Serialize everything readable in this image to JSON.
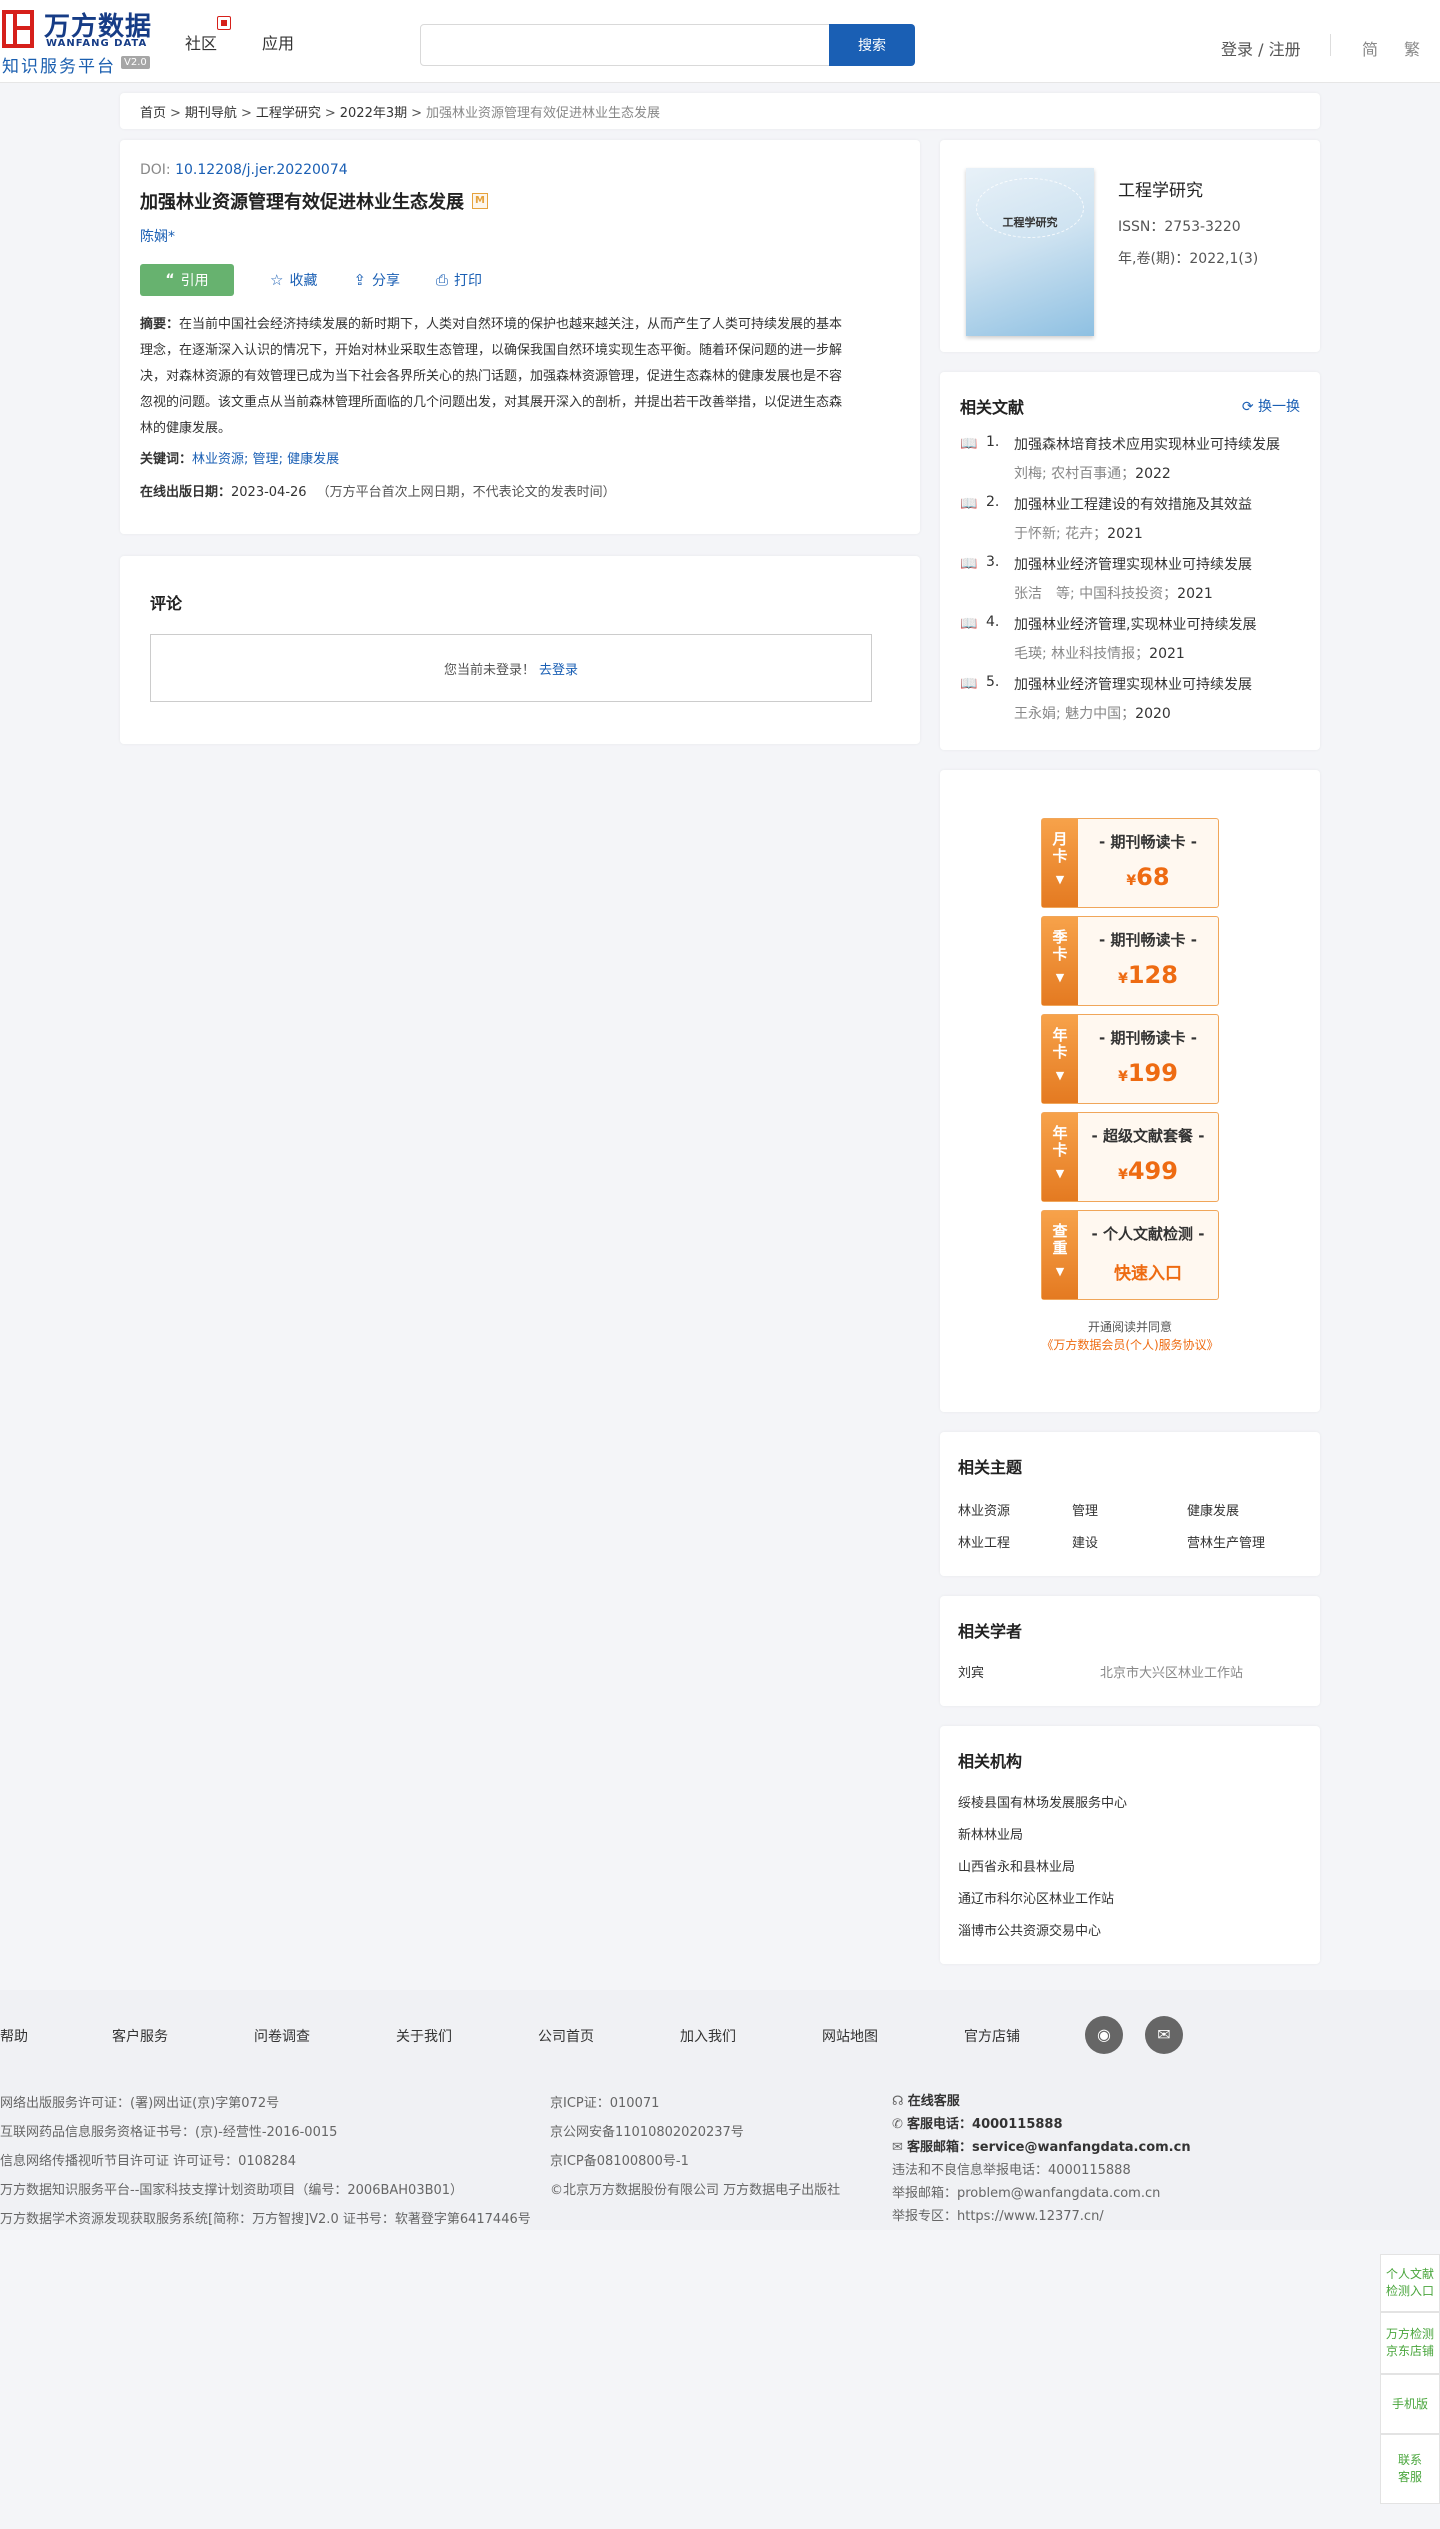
{
  "header": {
    "logo_cn": "万方数据",
    "logo_en": "WANFANG DATA",
    "logo_sub": "知识服务平台",
    "logo_ver": "V2.0",
    "nav": [
      "社区",
      "应用"
    ],
    "search_placeholder": "",
    "search_button": "搜索",
    "login": "登录 / 注册",
    "lang_simple": "简",
    "lang_trad": "繁"
  },
  "breadcrumb": {
    "items": [
      "首页",
      "期刊导航",
      "工程学研究",
      "2022年3期"
    ],
    "current": "加强林业资源管理有效促进林业生态发展",
    "sep": ">"
  },
  "article": {
    "doi_label": "DOI:",
    "doi": "10.12208/j.jer.20220074",
    "title": "加强林业资源管理有效促进林业生态发展",
    "badge": "M",
    "author": "陈娴*",
    "actions": {
      "cite": "引用",
      "favorite": "收藏",
      "share": "分享",
      "print": "打印"
    },
    "abstract_label": "摘要：",
    "abstract_lines": [
      "在当前中国社会经济持续发展的新时期下，人类对自然环境的保护也越来越关注，从而产生了人类可持续发展的基本",
      "理念，在逐渐深入认识的情况下，开始对林业采取生态管理，以确保我国自然环境实现生态平衡。随着环保问题的进一步解",
      "决，对森林资源的有效管理已成为当下社会各界所关心的热门话题，加强森林资源管理，促进生态森林的健康发展也是不容",
      "忽视的问题。该文重点从当前森林管理所面临的几个问题出发，对其展开深入的剖析，并提出若干改善举措，以促进生态森",
      "林的健康发展。"
    ],
    "keywords_label": "关键词：",
    "keywords": [
      "林业资源",
      "管理",
      "健康发展"
    ],
    "pubdate_label": "在线出版日期：",
    "pubdate": "2023-04-26",
    "pubdate_note": "（万方平台首次上网日期，不代表论文的发表时间）"
  },
  "comment": {
    "title": "评论",
    "not_logged": "您当前未登录！",
    "login_link": "去登录"
  },
  "journal": {
    "cover_title": "工程学研究",
    "name": "工程学研究",
    "issn": "ISSN：2753-3220",
    "volume": "年,卷(期)：2022,1(3)"
  },
  "related": {
    "title": "相关文献",
    "refresh": "换一换",
    "items": [
      {
        "num": "1.",
        "title": "加强森林培育技术应用实现林业可持续发展",
        "authors": "刘梅; 农村百事通；",
        "year": "2022"
      },
      {
        "num": "2.",
        "title": "加强林业工程建设的有效措施及其效益",
        "authors": "于怀新; 花卉；",
        "year": "2021"
      },
      {
        "num": "3.",
        "title": "加强林业经济管理实现林业可持续发展",
        "authors": "张洁　等; 中国科技投资；",
        "year": "2021"
      },
      {
        "num": "4.",
        "title": "加强林业经济管理,实现林业可持续发展",
        "authors": "毛瑛; 林业科技情报；",
        "year": "2021"
      },
      {
        "num": "5.",
        "title": "加强林业经济管理实现林业可持续发展",
        "authors": "王永娟; 魅力中国；",
        "year": "2020"
      }
    ]
  },
  "vip_cards": [
    {
      "tag": [
        "月",
        "卡"
      ],
      "name": "- 期刊畅读卡 -",
      "currency": "¥",
      "price": "68"
    },
    {
      "tag": [
        "季",
        "卡"
      ],
      "name": "- 期刊畅读卡 -",
      "currency": "¥",
      "price": "128"
    },
    {
      "tag": [
        "年",
        "卡"
      ],
      "name": "- 期刊畅读卡 -",
      "currency": "¥",
      "price": "199"
    },
    {
      "tag": [
        "年",
        "卡"
      ],
      "name": "- 超级文献套餐 -",
      "currency": "¥",
      "price": "499"
    },
    {
      "tag": [
        "查",
        "重"
      ],
      "name": "- 个人文献检测 -",
      "link": "快速入口"
    }
  ],
  "agreement": {
    "line1": "开通阅读并同意",
    "link": "《万方数据会员(个人)服务协议》"
  },
  "topics": {
    "title": "相关主题",
    "items": [
      "林业资源",
      "管理",
      "健康发展",
      "林业工程",
      "建设",
      "营林生产管理"
    ]
  },
  "scholars": {
    "title": "相关学者",
    "name": "刘宾",
    "org": "北京市大兴区林业工作站"
  },
  "orgs": {
    "title": "相关机构",
    "items": [
      "绥棱县国有林场发展服务中心",
      "新林林业局",
      "山西省永和县林业局",
      "通辽市科尔沁区林业工作站",
      "淄博市公共资源交易中心"
    ]
  },
  "footer": {
    "links": [
      "帮助",
      "客户服务",
      "问卷调查",
      "关于我们",
      "公司首页",
      "加入我们",
      "网站地图",
      "官方店铺"
    ],
    "col1": [
      "网络出版服务许可证：(署)网出证(京)字第072号",
      "互联网药品信息服务资格证书号：(京)-经营性-2016-0015",
      "信息网络传播视听节目许可证 许可证号：0108284",
      "万方数据知识服务平台--国家科技支撑计划资助项目（编号：2006BAH03B01）",
      "万方数据学术资源发现获取服务系统[简称：万方智搜]V2.0 证书号：软著登字第6417446号"
    ],
    "col2": [
      "京ICP证：010071",
      "京公网安备11010802020237号",
      "京ICP备08100800号-1",
      "©北京万方数据股份有限公司 万方数据电子出版社"
    ],
    "online": "在线客服",
    "phone_label": "客服电话：",
    "phone": "4000115888",
    "email_label": "客服邮箱：",
    "email": "service@wanfangdata.com.cn",
    "report_phone": "违法和不良信息举报电话：4000115888",
    "report_email": "举报邮箱：problem@wanfangdata.com.cn",
    "report_site": "举报专区：https://www.12377.cn/"
  },
  "side": {
    "check": "个人文献检测入口",
    "jd": "万方检测京东店铺",
    "mobile": "手机版",
    "contact": "联系客服"
  }
}
